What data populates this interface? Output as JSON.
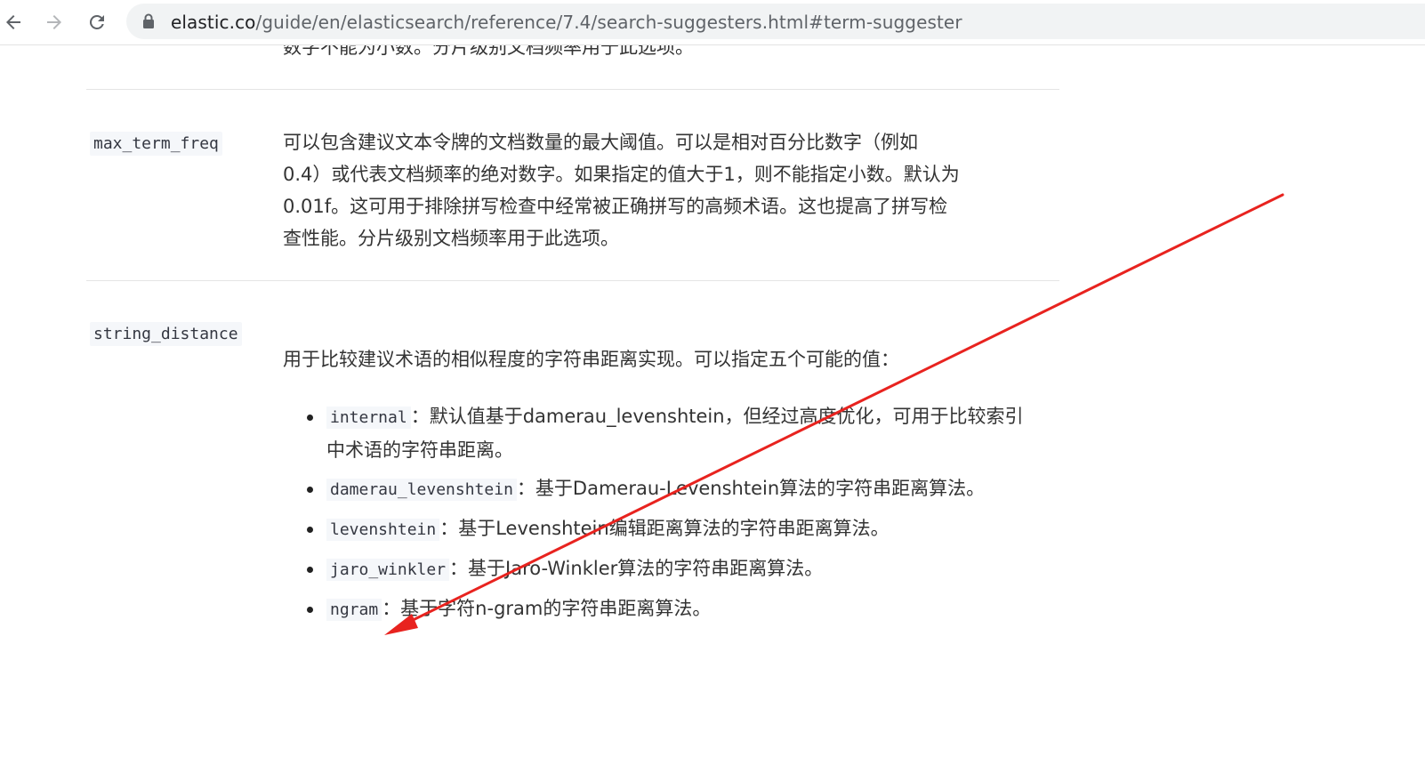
{
  "browser": {
    "url_domain": "elastic.co",
    "url_path": "/guide/en/elasticsearch/reference/7.4/search-suggesters.html#term-suggester",
    "icons": {
      "back": "arrow-left-icon",
      "forward": "arrow-right-icon",
      "reload": "reload-icon",
      "lock": "lock-icon"
    }
  },
  "page": {
    "clipped_text": "数字不能为小数。分片级别文档频率用于此选项。",
    "params": [
      {
        "name": "max_term_freq",
        "description": [
          "可以包含建议文本令牌的文档数量的最大阈值。可以是相对百分比数字（例如",
          "0.4）或代表文档频率的绝对数字。如果指定的值大于1，则不能指定小数。默认为",
          "0.01f。这可用于排除拼写检查中经常被正确拼写的高频术语。这也提高了拼写检",
          "查性能。分片级别文档频率用于此选项。"
        ]
      },
      {
        "name": "string_distance",
        "intro": "用于比较建议术语的相似程度的字符串距离实现。可以指定五个可能的值：",
        "options": [
          {
            "code": "internal",
            "text": "：默认值基于damerau_levenshtein，但经过高度优化，可用于比较索引中术语的字符串距离。"
          },
          {
            "code": "damerau_levenshtein",
            "text": "：基于Damerau-Levenshtein算法的字符串距离算法。"
          },
          {
            "code": "levenshtein",
            "text": "：基于Levenshtein编辑距离算法的字符串距离算法。"
          },
          {
            "code": "jaro_winkler",
            "text": "：基于Jaro-Winkler算法的字符串距离算法。"
          },
          {
            "code": "ngram",
            "text": "：基于字符n-gram的字符串距离算法。"
          }
        ]
      }
    ]
  },
  "annotation": {
    "arrow_color": "#e8231f"
  }
}
